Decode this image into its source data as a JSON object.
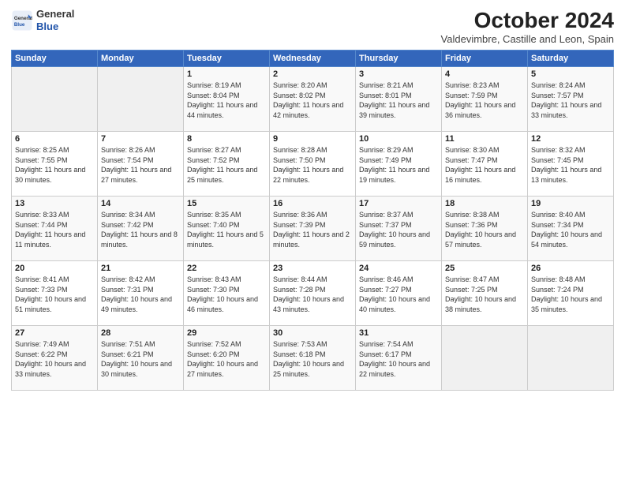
{
  "logo": {
    "line1": "General",
    "line2": "Blue"
  },
  "title": "October 2024",
  "subtitle": "Valdevimbre, Castille and Leon, Spain",
  "days_of_week": [
    "Sunday",
    "Monday",
    "Tuesday",
    "Wednesday",
    "Thursday",
    "Friday",
    "Saturday"
  ],
  "weeks": [
    [
      {
        "day": "",
        "detail": ""
      },
      {
        "day": "",
        "detail": ""
      },
      {
        "day": "1",
        "detail": "Sunrise: 8:19 AM\nSunset: 8:04 PM\nDaylight: 11 hours and 44 minutes."
      },
      {
        "day": "2",
        "detail": "Sunrise: 8:20 AM\nSunset: 8:02 PM\nDaylight: 11 hours and 42 minutes."
      },
      {
        "day": "3",
        "detail": "Sunrise: 8:21 AM\nSunset: 8:01 PM\nDaylight: 11 hours and 39 minutes."
      },
      {
        "day": "4",
        "detail": "Sunrise: 8:23 AM\nSunset: 7:59 PM\nDaylight: 11 hours and 36 minutes."
      },
      {
        "day": "5",
        "detail": "Sunrise: 8:24 AM\nSunset: 7:57 PM\nDaylight: 11 hours and 33 minutes."
      }
    ],
    [
      {
        "day": "6",
        "detail": "Sunrise: 8:25 AM\nSunset: 7:55 PM\nDaylight: 11 hours and 30 minutes."
      },
      {
        "day": "7",
        "detail": "Sunrise: 8:26 AM\nSunset: 7:54 PM\nDaylight: 11 hours and 27 minutes."
      },
      {
        "day": "8",
        "detail": "Sunrise: 8:27 AM\nSunset: 7:52 PM\nDaylight: 11 hours and 25 minutes."
      },
      {
        "day": "9",
        "detail": "Sunrise: 8:28 AM\nSunset: 7:50 PM\nDaylight: 11 hours and 22 minutes."
      },
      {
        "day": "10",
        "detail": "Sunrise: 8:29 AM\nSunset: 7:49 PM\nDaylight: 11 hours and 19 minutes."
      },
      {
        "day": "11",
        "detail": "Sunrise: 8:30 AM\nSunset: 7:47 PM\nDaylight: 11 hours and 16 minutes."
      },
      {
        "day": "12",
        "detail": "Sunrise: 8:32 AM\nSunset: 7:45 PM\nDaylight: 11 hours and 13 minutes."
      }
    ],
    [
      {
        "day": "13",
        "detail": "Sunrise: 8:33 AM\nSunset: 7:44 PM\nDaylight: 11 hours and 11 minutes."
      },
      {
        "day": "14",
        "detail": "Sunrise: 8:34 AM\nSunset: 7:42 PM\nDaylight: 11 hours and 8 minutes."
      },
      {
        "day": "15",
        "detail": "Sunrise: 8:35 AM\nSunset: 7:40 PM\nDaylight: 11 hours and 5 minutes."
      },
      {
        "day": "16",
        "detail": "Sunrise: 8:36 AM\nSunset: 7:39 PM\nDaylight: 11 hours and 2 minutes."
      },
      {
        "day": "17",
        "detail": "Sunrise: 8:37 AM\nSunset: 7:37 PM\nDaylight: 10 hours and 59 minutes."
      },
      {
        "day": "18",
        "detail": "Sunrise: 8:38 AM\nSunset: 7:36 PM\nDaylight: 10 hours and 57 minutes."
      },
      {
        "day": "19",
        "detail": "Sunrise: 8:40 AM\nSunset: 7:34 PM\nDaylight: 10 hours and 54 minutes."
      }
    ],
    [
      {
        "day": "20",
        "detail": "Sunrise: 8:41 AM\nSunset: 7:33 PM\nDaylight: 10 hours and 51 minutes."
      },
      {
        "day": "21",
        "detail": "Sunrise: 8:42 AM\nSunset: 7:31 PM\nDaylight: 10 hours and 49 minutes."
      },
      {
        "day": "22",
        "detail": "Sunrise: 8:43 AM\nSunset: 7:30 PM\nDaylight: 10 hours and 46 minutes."
      },
      {
        "day": "23",
        "detail": "Sunrise: 8:44 AM\nSunset: 7:28 PM\nDaylight: 10 hours and 43 minutes."
      },
      {
        "day": "24",
        "detail": "Sunrise: 8:46 AM\nSunset: 7:27 PM\nDaylight: 10 hours and 40 minutes."
      },
      {
        "day": "25",
        "detail": "Sunrise: 8:47 AM\nSunset: 7:25 PM\nDaylight: 10 hours and 38 minutes."
      },
      {
        "day": "26",
        "detail": "Sunrise: 8:48 AM\nSunset: 7:24 PM\nDaylight: 10 hours and 35 minutes."
      }
    ],
    [
      {
        "day": "27",
        "detail": "Sunrise: 7:49 AM\nSunset: 6:22 PM\nDaylight: 10 hours and 33 minutes."
      },
      {
        "day": "28",
        "detail": "Sunrise: 7:51 AM\nSunset: 6:21 PM\nDaylight: 10 hours and 30 minutes."
      },
      {
        "day": "29",
        "detail": "Sunrise: 7:52 AM\nSunset: 6:20 PM\nDaylight: 10 hours and 27 minutes."
      },
      {
        "day": "30",
        "detail": "Sunrise: 7:53 AM\nSunset: 6:18 PM\nDaylight: 10 hours and 25 minutes."
      },
      {
        "day": "31",
        "detail": "Sunrise: 7:54 AM\nSunset: 6:17 PM\nDaylight: 10 hours and 22 minutes."
      },
      {
        "day": "",
        "detail": ""
      },
      {
        "day": "",
        "detail": ""
      }
    ]
  ]
}
